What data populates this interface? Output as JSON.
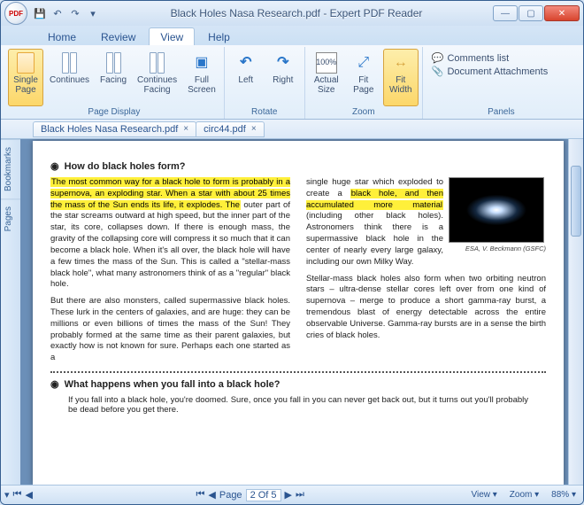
{
  "title": "Black Holes Nasa Research.pdf - Expert PDF Reader",
  "app_orb": "PDF",
  "menu_tabs": {
    "items": [
      "Home",
      "Review",
      "View",
      "Help"
    ],
    "active": 2
  },
  "ribbon": {
    "page_display": {
      "label": "Page Display",
      "single": "Single\nPage",
      "continues": "Continues",
      "facing": "Facing",
      "cont_facing": "Continues\nFacing",
      "full": "Full\nScreen"
    },
    "rotate": {
      "label": "Rotate",
      "left": "Left",
      "right": "Right"
    },
    "zoom": {
      "label": "Zoom",
      "actual": "Actual\nSize",
      "actual_badge": "100%",
      "fit_page": "Fit\nPage",
      "fit_width": "Fit\nWidth"
    },
    "panels": {
      "label": "Panels",
      "comments": "Comments list",
      "attachments": "Document Attachments"
    }
  },
  "doc_tabs": [
    {
      "label": "Black Holes Nasa Research.pdf"
    },
    {
      "label": "circ44.pdf"
    }
  ],
  "side": {
    "bookmarks": "Bookmarks",
    "pages": "Pages"
  },
  "content": {
    "h1": "How do black holes form?",
    "p1a_hl": "The most common way for a black hole to form is probably in a supernova, an exploding star. When a star with about 25 times the mass of the Sun ends its life, it explodes. The",
    "p1b": " outer part of the star screams outward at high speed, but the inner part of the star, its core, collapses down. If there is enough mass, the gravity of the collapsing core will compress it so much that it can become a black hole. When it's all over, the black hole will have a few times the mass of the Sun. This is called a \"stellar-mass black hole\", what many astronomers think of as a \"regular\" black hole.",
    "p2": "But there are also monsters, called supermassive black holes. These lurk in the centers of galaxies, and are huge: they can be millions or even billions of times the mass of the Sun! They probably formed at the same time as their parent galaxies, but exactly how is not known for sure. Perhaps each one started as a",
    "p3a": "single huge star which exploded to create a ",
    "p3_hl": "black hole, and then accumulated more material",
    "p3b": " (including other black holes). Astronomers think there is a supermassive black hole in the center of nearly every large galaxy, including our own Milky Way.",
    "p4": "Stellar-mass black holes also form when two orbiting neutron stars – ultra-dense stellar cores left over from one kind of supernova – merge to produce a short gamma-ray burst, a tremendous blast of energy detectable across the entire observable Universe. Gamma-ray bursts are in a sense the birth cries of black holes.",
    "caption": "ESA, V. Beckmann (GSFC)",
    "h2": "What happens when you fall into a black hole?",
    "p5": "If you fall into a black hole, you're doomed. Sure, once you fall in you can never get back out, but it turns out you'll probably be dead before you get there."
  },
  "status": {
    "page_label": "Page",
    "page_value": "2 Of 5",
    "view": "View",
    "zoom": "Zoom",
    "zoom_value": "88%"
  }
}
